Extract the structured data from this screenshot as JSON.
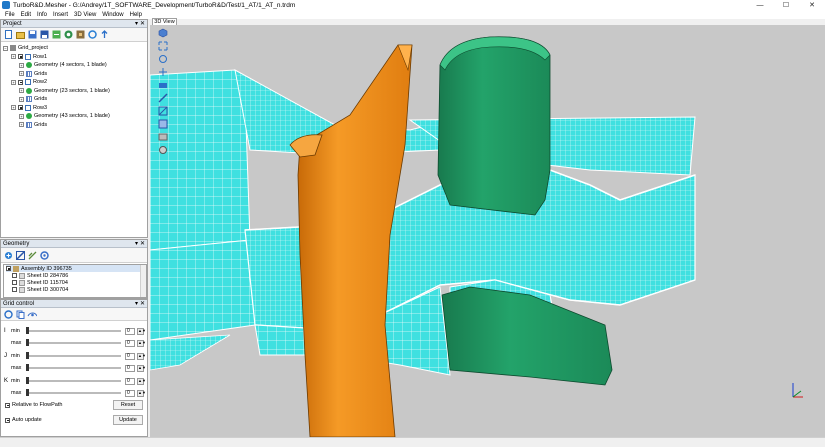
{
  "window": {
    "title": "TurboR&D.Mesher - G:/Andrey/1T_SOFTWARE_Development/TurboR&D/Test/1_AT/1_AT_n.trdm",
    "minimize": "—",
    "maximize": "☐",
    "close": "✕"
  },
  "menu": [
    "File",
    "Edit",
    "Info",
    "Insert",
    "3D View",
    "Window",
    "Help"
  ],
  "project": {
    "title": "Project",
    "tree": [
      {
        "label": "Grid_project",
        "level": 0,
        "icon": "project-icon"
      },
      {
        "label": "Row1",
        "level": 1,
        "icon": "row-icon"
      },
      {
        "label": "Geometry (4 sectors, 1 blade)",
        "level": 2,
        "icon": "geometry-icon"
      },
      {
        "label": "Grids",
        "level": 2,
        "icon": "grids-icon"
      },
      {
        "label": "Row2",
        "level": 1,
        "icon": "row-icon"
      },
      {
        "label": "Geometry (23 sectors, 1 blade)",
        "level": 2,
        "icon": "geometry-icon"
      },
      {
        "label": "Grids",
        "level": 2,
        "icon": "grids-icon"
      },
      {
        "label": "Row3",
        "level": 1,
        "icon": "row-icon"
      },
      {
        "label": "Geometry (43 sectors, 1 blade)",
        "level": 2,
        "icon": "geometry-icon"
      },
      {
        "label": "Grids",
        "level": 2,
        "icon": "grids-icon"
      }
    ]
  },
  "geometry": {
    "title": "Geometry",
    "items": [
      {
        "label": "Assembly ID 396735",
        "checked": true
      },
      {
        "label": "Sheet ID 284786",
        "checked": false
      },
      {
        "label": "Sheet ID 115704",
        "checked": false
      },
      {
        "label": "Sheet ID 300704",
        "checked": false
      }
    ]
  },
  "grid_control": {
    "title": "Grid control",
    "rows": [
      {
        "axis": "I",
        "label": "min",
        "value": "0"
      },
      {
        "axis": "",
        "label": "max",
        "value": "0"
      },
      {
        "axis": "J",
        "label": "min",
        "value": "0"
      },
      {
        "axis": "",
        "label": "max",
        "value": "0"
      },
      {
        "axis": "K",
        "label": "min",
        "value": "0"
      },
      {
        "axis": "",
        "label": "max",
        "value": "0"
      }
    ],
    "relative_label": "Relative to FlowPath",
    "auto_update_label": "Auto update",
    "reset_label": "Reset",
    "update_label": "Update"
  },
  "view": {
    "tab_label": "3D View"
  },
  "colors": {
    "mesh": "#3fe0e0",
    "blade_orange": "#f28c1a",
    "blade_green": "#1f9a63",
    "viewport_bg": "#c8c8c8"
  }
}
